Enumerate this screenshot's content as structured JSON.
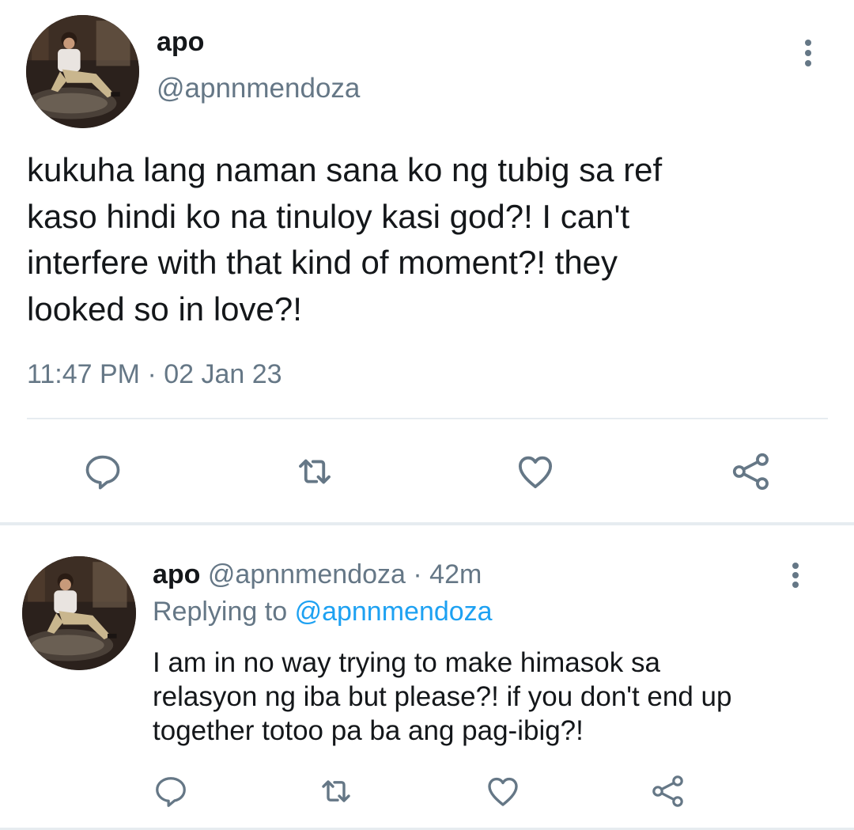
{
  "main_tweet": {
    "name": "apo",
    "handle": "@apnnmendoza",
    "text": "kukuha lang naman sana ko ng tubig sa ref\nkaso hindi ko na tinuloy kasi god?! I can't\ninterfere with that kind of moment?! they\nlooked so in love?!",
    "time": "11:47 PM",
    "separator": " · ",
    "date": "02 Jan 23",
    "actions": [
      "reply-icon",
      "retweet-icon",
      "like-icon",
      "share-icon"
    ]
  },
  "reply_tweet": {
    "name": "apo",
    "handle": "@apnnmendoza",
    "separator": " · ",
    "age": "42m",
    "replying_label": "Replying to",
    "replying_handle": "@apnnmendoza",
    "text": "I am in no way trying to make himasok sa\nrelasyon ng iba but please?! if you don't end up\ntogether totoo pa ba ang pag-ibig?!",
    "actions": [
      "reply-icon",
      "retweet-icon",
      "like-icon",
      "share-icon"
    ]
  },
  "colors": {
    "text_primary": "#14171a",
    "text_secondary": "#657786",
    "link": "#1da1f2",
    "divider": "#e6ecf0",
    "icon": "#657786"
  }
}
